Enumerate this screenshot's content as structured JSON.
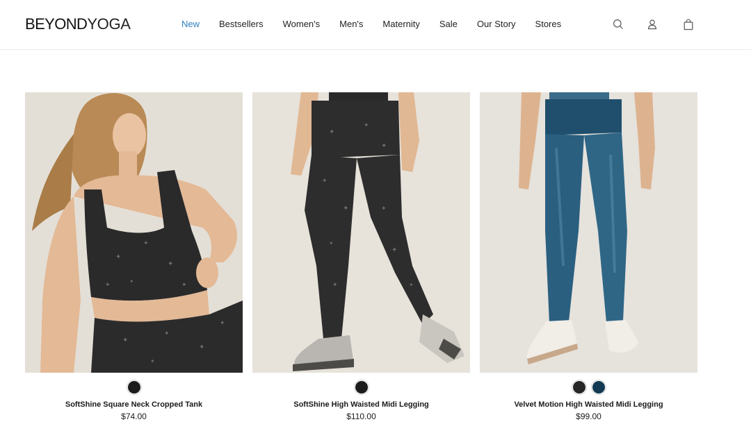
{
  "header": {
    "logo_bold": "BEYOND",
    "logo_light": "YOGA",
    "nav": [
      {
        "label": "New",
        "active": true
      },
      {
        "label": "Bestsellers",
        "active": false
      },
      {
        "label": "Women's",
        "active": false
      },
      {
        "label": "Men's",
        "active": false
      },
      {
        "label": "Maternity",
        "active": false
      },
      {
        "label": "Sale",
        "active": false
      },
      {
        "label": "Our Story",
        "active": false
      },
      {
        "label": "Stores",
        "active": false
      }
    ],
    "icons": [
      "search-icon",
      "account-icon",
      "shopping-bag-icon"
    ],
    "accent_color": "#2d7fc0"
  },
  "products": [
    {
      "name": "SoftShine Square Neck Cropped Tank",
      "price": "$74.00",
      "swatches": [
        "#1c1c1c"
      ]
    },
    {
      "name": "SoftShine High Waisted Midi Legging",
      "price": "$110.00",
      "swatches": [
        "#1c1c1c"
      ]
    },
    {
      "name": "Velvet Motion High Waisted Midi Legging",
      "price": "$99.00",
      "swatches": [
        "#262626",
        "#123a52"
      ]
    }
  ]
}
